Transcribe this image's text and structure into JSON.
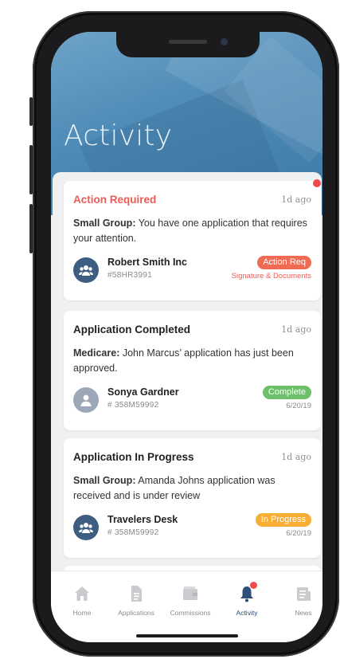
{
  "header": {
    "title": "Activity"
  },
  "cards": [
    {
      "title": "Action Required",
      "time": "1d ago",
      "msg_prefix": "Small Group:",
      "msg_body": " You have one application that requires your attention.",
      "client_name": "Robert Smith Inc",
      "client_id": "#58HR3991",
      "badge": "Action Req",
      "sub_right": "Signature & Documents"
    },
    {
      "title": "Application Completed",
      "time": "1d ago",
      "msg_prefix": "Medicare:",
      "msg_body": " John Marcus’ application has just been approved.",
      "client_name": "Sonya Gardner",
      "client_id": "# 358M59992",
      "badge": "Complete",
      "sub_right": "6/20/19"
    },
    {
      "title": "Application In Progress",
      "time": "1d ago",
      "msg_prefix": "Small Group:",
      "msg_body": " Amanda Johns application was received and is under review",
      "client_name": "Travelers Desk",
      "client_id": "# 358M59992",
      "badge": "In Progress",
      "sub_right": "6/20/19"
    }
  ],
  "tabs": [
    {
      "label": "Home",
      "icon": "home-icon"
    },
    {
      "label": "Applications",
      "icon": "document-icon"
    },
    {
      "label": "Commissions",
      "icon": "wallet-icon"
    },
    {
      "label": "Activity",
      "icon": "bell-icon",
      "active": true
    },
    {
      "label": "News",
      "icon": "newspaper-icon"
    }
  ],
  "colors": {
    "accent": "#2c4e79",
    "alert": "#ee5a55",
    "complete": "#6cc069",
    "in_progress": "#f6ae35",
    "header": "#4d8ab6"
  }
}
